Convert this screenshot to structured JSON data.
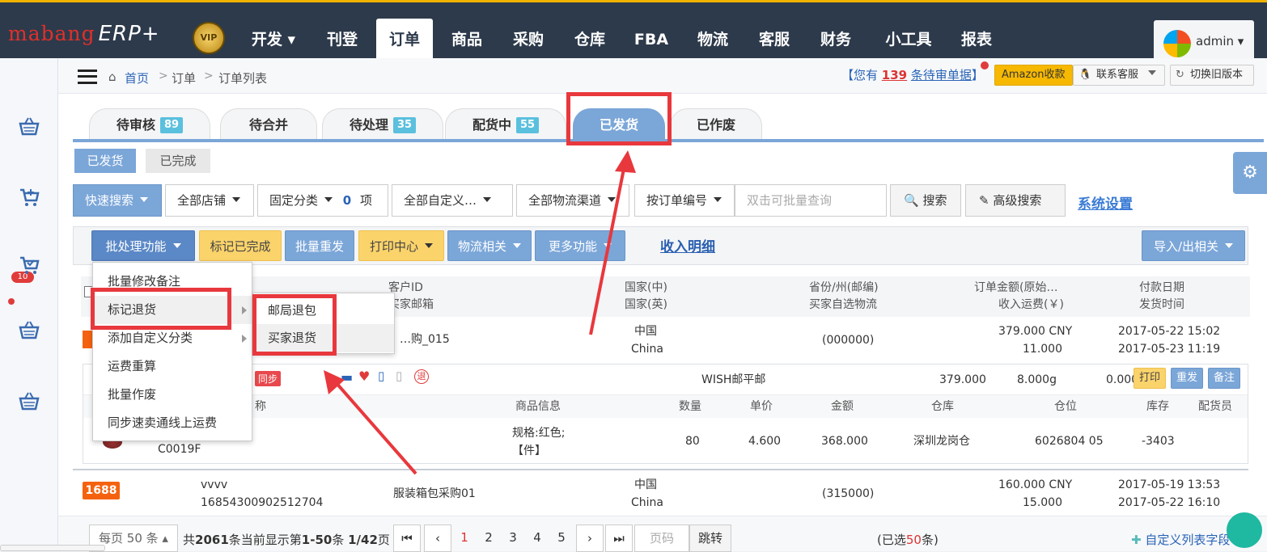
{
  "topnav": {
    "logo_text": "mabang",
    "logo_erp": "ERP+",
    "vip_badge": "VIP",
    "items": [
      {
        "label": "开发 ▾"
      },
      {
        "label": "刊登"
      },
      {
        "label": "订单"
      },
      {
        "label": "商品"
      },
      {
        "label": "采购"
      },
      {
        "label": "仓库"
      },
      {
        "label": "FBA"
      },
      {
        "label": "物流"
      },
      {
        "label": "客服"
      },
      {
        "label": "财务"
      },
      {
        "label": "小工具"
      },
      {
        "label": "报表"
      }
    ],
    "active_index": 2,
    "user": "admin ▾"
  },
  "sidebar": {
    "cart_badge": "10"
  },
  "breadcrumb": {
    "home": "首页",
    "order": "订单",
    "list": "订单列表"
  },
  "header_right": {
    "pending_prefix": "【您有",
    "pending_count": "139",
    "pending_suffix": "条待审单据",
    "pending_close": "】",
    "amazon_btn": "Amazon收款",
    "contact_btn": "联系客服",
    "switch_btn": "切换旧版本"
  },
  "tabs": [
    {
      "label": "待审核",
      "count": "89"
    },
    {
      "label": "待合并",
      "count": ""
    },
    {
      "label": "待处理",
      "count": "35"
    },
    {
      "label": "配货中",
      "count": "55"
    },
    {
      "label": "已发货",
      "count": ""
    },
    {
      "label": "已作废",
      "count": ""
    }
  ],
  "subtabs": {
    "shipped": "已发货",
    "completed": "已完成"
  },
  "filters": {
    "quick_search": "快速搜索",
    "all_stores": "全部店铺",
    "fixed_category": "固定分类",
    "category_count": "0",
    "category_unit": "项",
    "all_custom": "全部自定义…",
    "all_logistics": "全部物流渠道",
    "by_order_no": "按订单编号",
    "search_placeholder": "双击可批量查询",
    "search_btn": "搜索",
    "advanced_btn": "高级搜索",
    "settings_link": "系统设置"
  },
  "actions": {
    "batch": "批处理功能",
    "mark_done": "标记已完成",
    "batch_resend": "批量重发",
    "print_center": "打印中心",
    "logistics": "物流相关",
    "more": "更多功能",
    "income_detail": "收入明细",
    "import_export": "导入/出相关"
  },
  "table_header": {
    "customer_id": "客户ID",
    "buyer_email": "买家邮箱",
    "country_cn": "国家(中)",
    "country_en": "国家(英)",
    "province": "省份/州(邮编)",
    "buyer_logistics": "买家自选物流",
    "order_amount": "订单金额(原始…",
    "shipping_income": "收入运费(￥)",
    "pay_date": "付款日期",
    "ship_date": "发货时间"
  },
  "order1": {
    "customer": "…购_015",
    "country_cn": "中国",
    "country_en": "China",
    "province": "(000000)",
    "amount": "379.000 CNY",
    "shipping": "11.000",
    "pay_date": "2017-05-22 15:02",
    "ship_date": "2017-05-23 11:19",
    "sync_tag": "同步",
    "logistics": "WISH邮平邮",
    "total": "379.000",
    "weight": "8.000g",
    "fee": "0.000",
    "print_btn": "打印",
    "resend_btn": "重发",
    "note_btn": "备注",
    "sub_header": {
      "name": "称",
      "goods_info": "商品信息",
      "qty": "数量",
      "unit_price": "单价",
      "amount": "金额",
      "warehouse": "仓库",
      "location": "仓位",
      "stock": "库存",
      "picker": "配货员"
    },
    "item": {
      "sku": "C0019F",
      "spec": "规格:红色;",
      "unit": "【件】",
      "qty": "80",
      "price": "4.600",
      "amount": "368.000",
      "warehouse": "深圳龙岗仓",
      "location": "6026804 05",
      "stock": "-3403"
    }
  },
  "order2": {
    "tag": "1688",
    "name": "vvvv",
    "order_no": "16854300902512704",
    "customer": "服装箱包采购01",
    "country_cn": "中国",
    "country_en": "China",
    "province": "(315000)",
    "amount": "160.000 CNY",
    "shipping": "15.000",
    "pay_date": "2017-05-19 13:53",
    "ship_date": "2017-05-22 16:10"
  },
  "pager": {
    "per_page": "每页 50 条 ▴",
    "summary_a": "共",
    "total": "2061",
    "summary_b": "条当前显示第",
    "range": "1-50",
    "summary_c": "条",
    "page_info": "1/42",
    "summary_d": "页",
    "pages": [
      "1",
      "2",
      "3",
      "4",
      "5"
    ],
    "page_placeholder": "页码",
    "jump": "跳转",
    "selected_a": "(已选",
    "selected_count": "50",
    "selected_b": "条)",
    "custom_fields": "自定义列表字段"
  },
  "dropdown_batch": {
    "items": [
      {
        "label": "批量修改备注"
      },
      {
        "label": "标记退货"
      },
      {
        "label": "添加自定义分类"
      },
      {
        "label": "运费重算"
      },
      {
        "label": "批量作废"
      },
      {
        "label": "同步速卖通线上运费"
      }
    ]
  },
  "dropdown_return": {
    "items": [
      {
        "label": "邮局退包"
      },
      {
        "label": "买家退货"
      }
    ]
  },
  "colors": {
    "nav_bg": "#2d3a4b",
    "accent_blue": "#7ba6d8",
    "highlight_red": "#e8383d",
    "tag_orange": "#f5620f"
  }
}
